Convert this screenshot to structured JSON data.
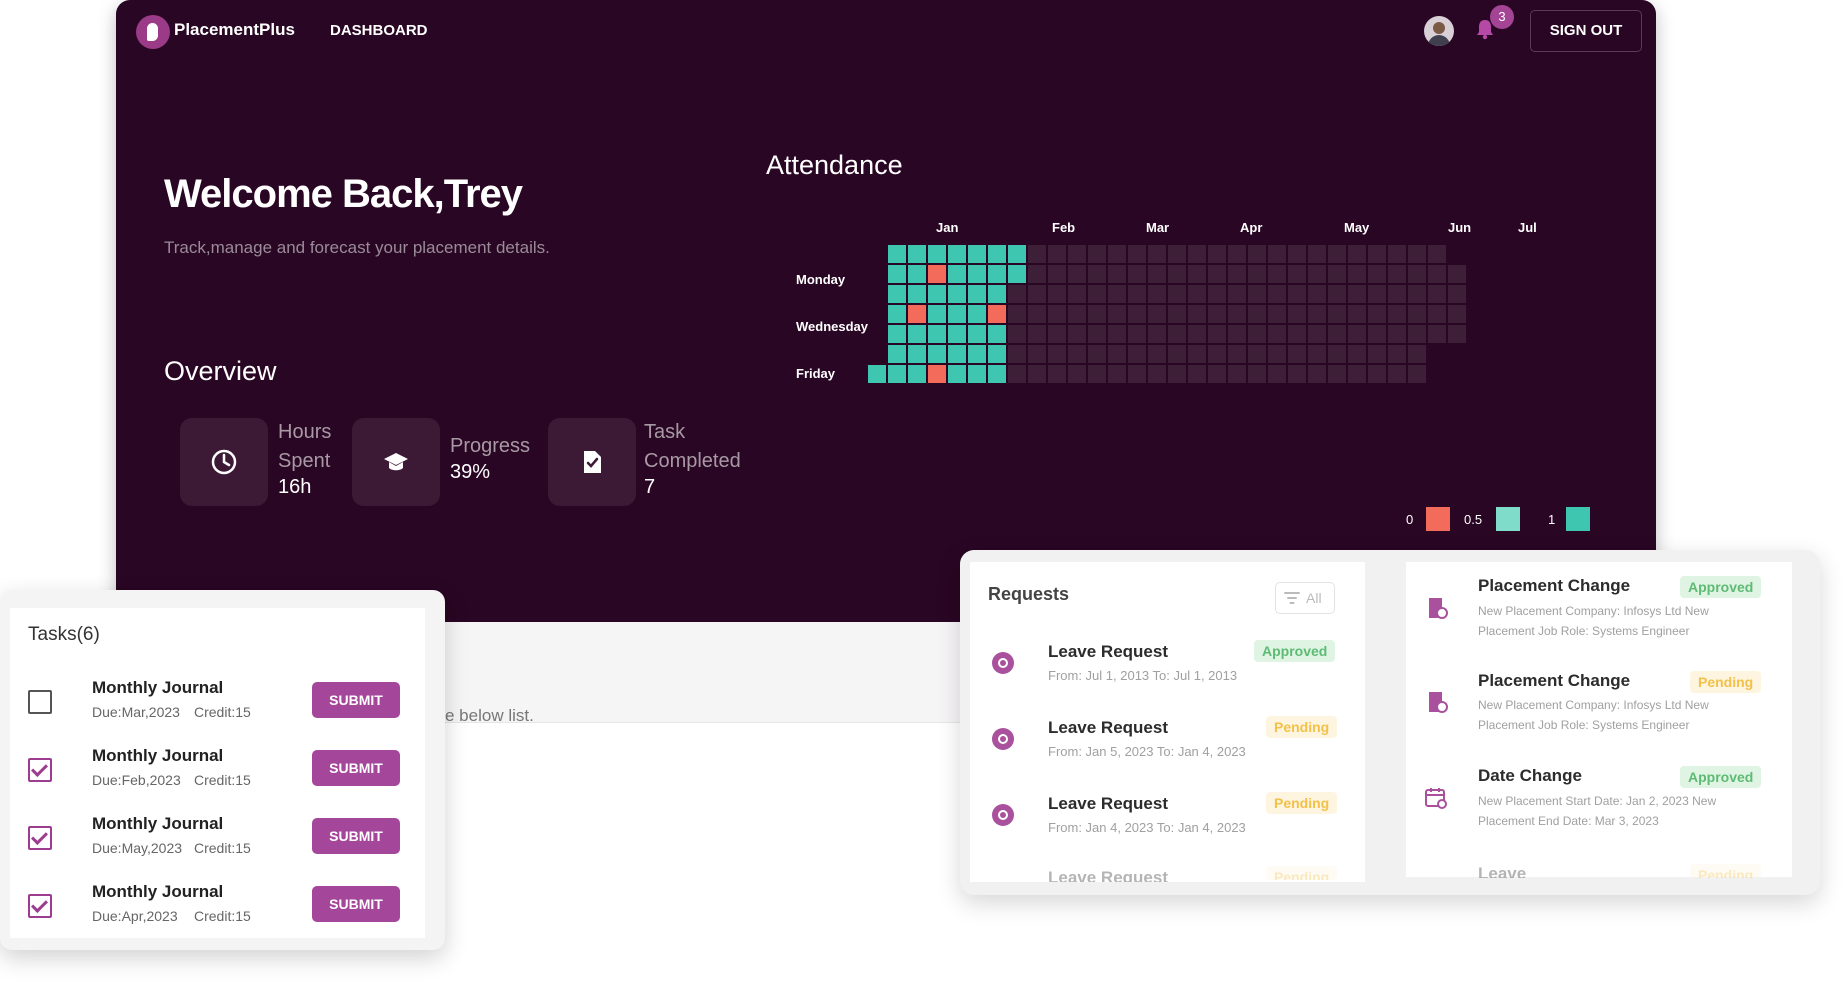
{
  "header": {
    "brand": "PlacementPlus",
    "nav_dashboard": "DASHBOARD",
    "notification_count": "3",
    "sign_out": "SIGN OUT"
  },
  "hero": {
    "welcome": "Welcome Back,Trey",
    "subtitle": "Track,manage and forecast your placement details."
  },
  "overview": {
    "title": "Overview",
    "stats": [
      {
        "label_lines": [
          "Hours",
          "Spent"
        ],
        "value": "16h",
        "icon": "clock-icon"
      },
      {
        "label_lines": [
          "Progress"
        ],
        "value": "39%",
        "icon": "graduation-cap-icon"
      },
      {
        "label_lines": [
          "Task",
          "Completed"
        ],
        "value": "7",
        "icon": "document-check-icon"
      }
    ]
  },
  "attendance": {
    "title": "Attendance",
    "months": [
      "Jan",
      "Feb",
      "Mar",
      "Apr",
      "May",
      "Jun",
      "Jul"
    ],
    "day_labels": [
      "Monday",
      "Wednesday",
      "Friday"
    ],
    "legend": [
      {
        "label": "0",
        "color": "#f26b5b"
      },
      {
        "label": "0.5",
        "color": "#7fdccb"
      },
      {
        "label": "1",
        "color": "#3fc6b0"
      }
    ],
    "colors": {
      "present": "#3fc6b0",
      "absent": "#f26b5b",
      "empty": "#3d1f38"
    }
  },
  "band": {
    "text": "e below list."
  },
  "tasks": {
    "title": "Tasks(6)",
    "items": [
      {
        "title": "Monthly Journal",
        "due": "Due:Mar,2023",
        "credit": "Credit:15",
        "checked": false,
        "action": "SUBMIT"
      },
      {
        "title": "Monthly Journal",
        "due": "Due:Feb,2023",
        "credit": "Credit:15",
        "checked": true,
        "action": "SUBMIT"
      },
      {
        "title": "Monthly Journal",
        "due": "Due:May,2023",
        "credit": "Credit:15",
        "checked": true,
        "action": "SUBMIT"
      },
      {
        "title": "Monthly Journal",
        "due": "Due:Apr,2023",
        "credit": "Credit:15",
        "checked": true,
        "action": "SUBMIT"
      }
    ]
  },
  "requests": {
    "title": "Requests",
    "filter_label": "All",
    "left": [
      {
        "title": "Leave Request",
        "meta": "From: Jul 1, 2013   To: Jul 1, 2013",
        "status": "Approved"
      },
      {
        "title": "Leave Request",
        "meta": "From: Jan 5, 2023   To: Jan 4, 2023",
        "status": "Pending"
      },
      {
        "title": "Leave Request",
        "meta": "From: Jan 4, 2023   To: Jan 4, 2023",
        "status": "Pending"
      },
      {
        "title": "Leave Request",
        "meta": "",
        "status": "Pending"
      }
    ],
    "right": [
      {
        "title": "Placement Change",
        "line1": "New Placement Company: Infosys Ltd   New",
        "line2": "Placement Job Role: Systems Engineer",
        "status": "Approved"
      },
      {
        "title": "Placement Change",
        "line1": "New Placement Company: Infosys Ltd   New",
        "line2": "Placement Job Role: Systems Engineer",
        "status": "Pending"
      },
      {
        "title": "Date Change",
        "line1": "New Placement Start Date: Jan 2, 2023   New",
        "line2": "Placement End Date: Mar 3, 2023",
        "status": "Approved"
      },
      {
        "title": "Leave",
        "line1": "",
        "line2": "",
        "status": "Pending"
      }
    ]
  }
}
